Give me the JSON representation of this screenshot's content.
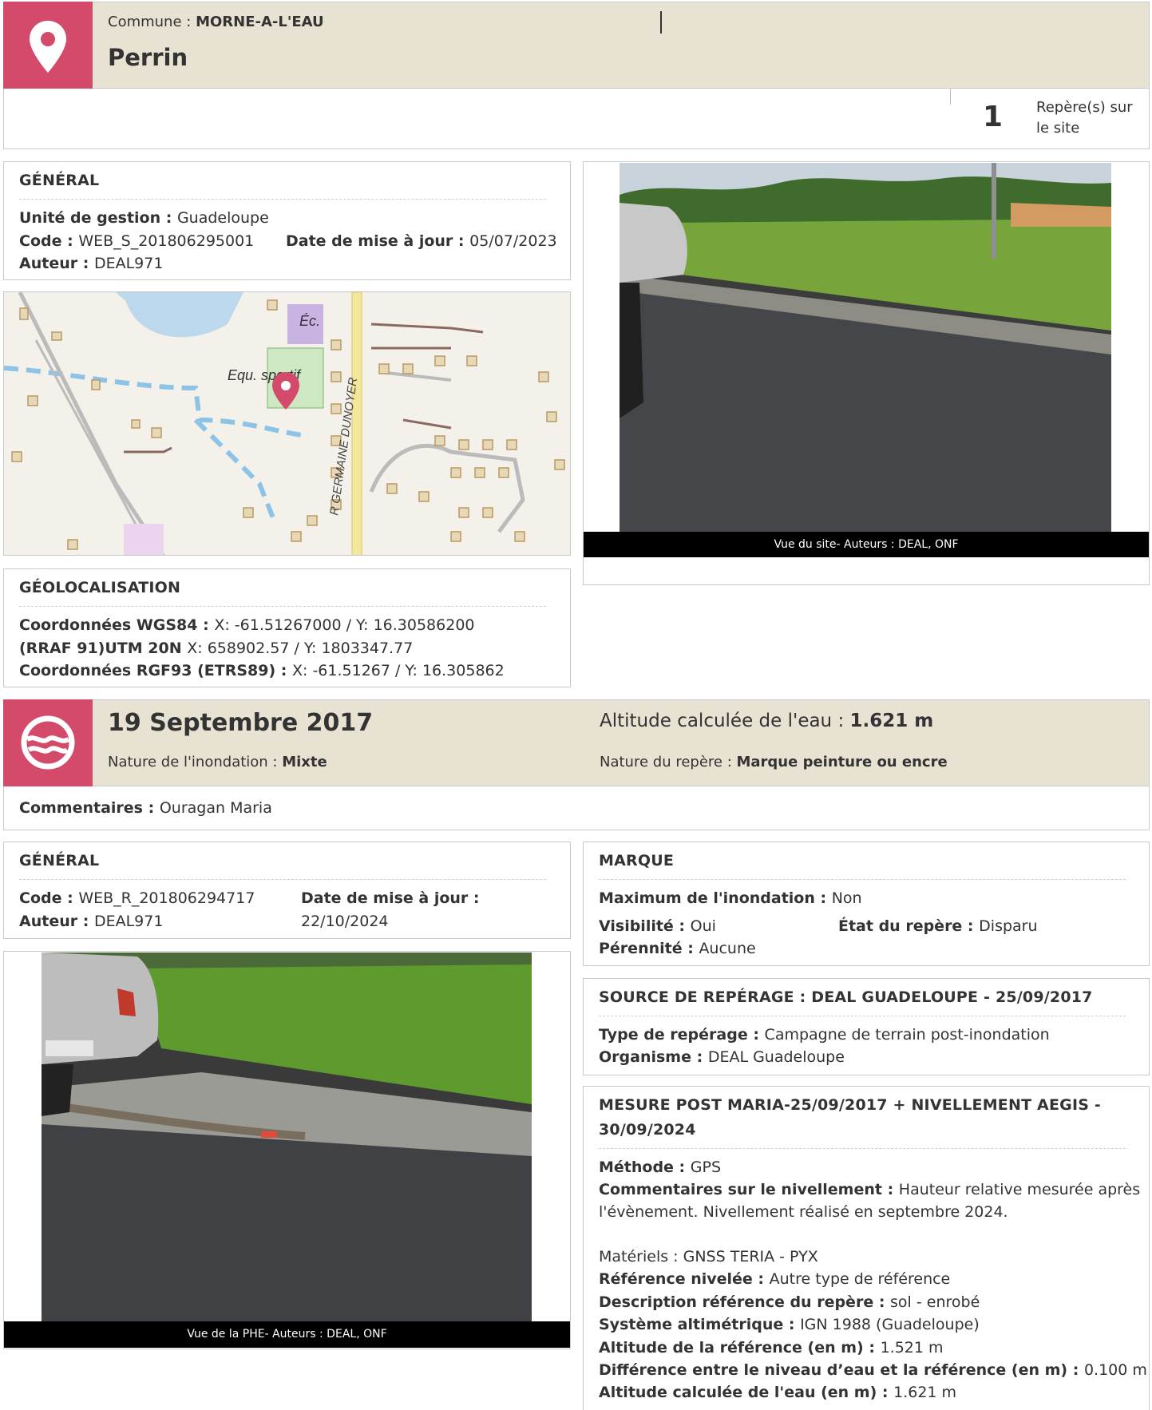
{
  "site": {
    "commune_label": "Commune : ",
    "commune": "MORNE-A-L'EAU",
    "name": "Perrin",
    "count": "1",
    "count_label": "Repère(s) sur le site"
  },
  "general1": {
    "heading": "GÉNÉRAL",
    "unite_label": "Unité de gestion : ",
    "unite": "Guadeloupe",
    "code_label": "Code : ",
    "code": "WEB_S_201806295001",
    "date_label": "Date de mise à jour : ",
    "date": "05/07/2023",
    "auteur_label": "Auteur : ",
    "auteur": "DEAL971"
  },
  "map": {
    "label_ec": "Éc.",
    "label_equ": "Equ. sportif",
    "label_road": "R GERMAINE DUNOYER"
  },
  "photo1": {
    "caption": "Vue du site- Auteurs : DEAL, ONF"
  },
  "geo": {
    "heading": "GÉOLOCALISATION",
    "wgs_label": "Coordonnées WGS84 : ",
    "wgs": "X: -61.51267000 / Y: 16.30586200",
    "utm_label": "(RRAF 91)UTM 20N ",
    "utm": "X: 658902.57 / Y: 1803347.77",
    "rgf_label": "Coordonnées RGF93 (ETRS89) : ",
    "rgf": "X: -61.51267 / Y: 16.305862"
  },
  "event": {
    "date": "19 Septembre 2017",
    "nature_label": "Nature de l'inondation : ",
    "nature": "Mixte",
    "alt_label": "Altitude calculée de l'eau : ",
    "alt": "1.621 m",
    "repere_label": "Nature du repère : ",
    "repere": "Marque peinture ou encre",
    "comment_label": "Commentaires : ",
    "comment": "Ouragan Maria"
  },
  "general2": {
    "heading": "GÉNÉRAL",
    "code_label": "Code : ",
    "code": "WEB_R_201806294717",
    "date_label": "Date de mise à jour :",
    "date": "22/10/2024",
    "auteur_label": "Auteur : ",
    "auteur": "DEAL971"
  },
  "photo2": {
    "caption": "Vue de la PHE- Auteurs : DEAL, ONF"
  },
  "marque": {
    "heading": "MARQUE",
    "max_label": "Maximum de l'inondation : ",
    "max": "Non",
    "vis_label": "Visibilité : ",
    "vis": "Oui",
    "etat_label": "État du repère : ",
    "etat": "Disparu",
    "per_label": "Pérennité : ",
    "per": "Aucune"
  },
  "source": {
    "heading": "SOURCE DE REPÉRAGE : DEAL GUADELOUPE - 25/09/2017",
    "type_label": "Type de repérage : ",
    "type": "Campagne de terrain post-inondation",
    "org_label": "Organisme : ",
    "org": "DEAL Guadeloupe"
  },
  "mesure": {
    "heading1": "MESURE POST MARIA-25/09/2017 + NIVELLEMENT AEGIS -",
    "heading2": "30/09/2024",
    "methode_label": "Méthode : ",
    "methode": "GPS",
    "comm_label": "Commentaires sur le nivellement : ",
    "comm1": "Hauteur relative mesurée après",
    "comm2": "l'évènement. Nivellement réalisé en septembre 2024.",
    "materiels": "Matériels : GNSS TERIA - PYX",
    "ref_label": "Référence nivelée : ",
    "ref": "Autre type de référence",
    "desc_label": "Description référence du repère : ",
    "desc": "sol - enrobé",
    "sys_label": "Système altimétrique : ",
    "sys": "IGN 1988 (Guadeloupe)",
    "altref_label": "Altitude de la référence (en m) : ",
    "altref": "1.521 m",
    "diff_label": "Différence entre le niveau d’eau et la référence (en m) : ",
    "diff": "0.100 m",
    "altcalc_label": "Altitude calculée de l'eau (en m) : ",
    "altcalc": "1.621 m"
  }
}
